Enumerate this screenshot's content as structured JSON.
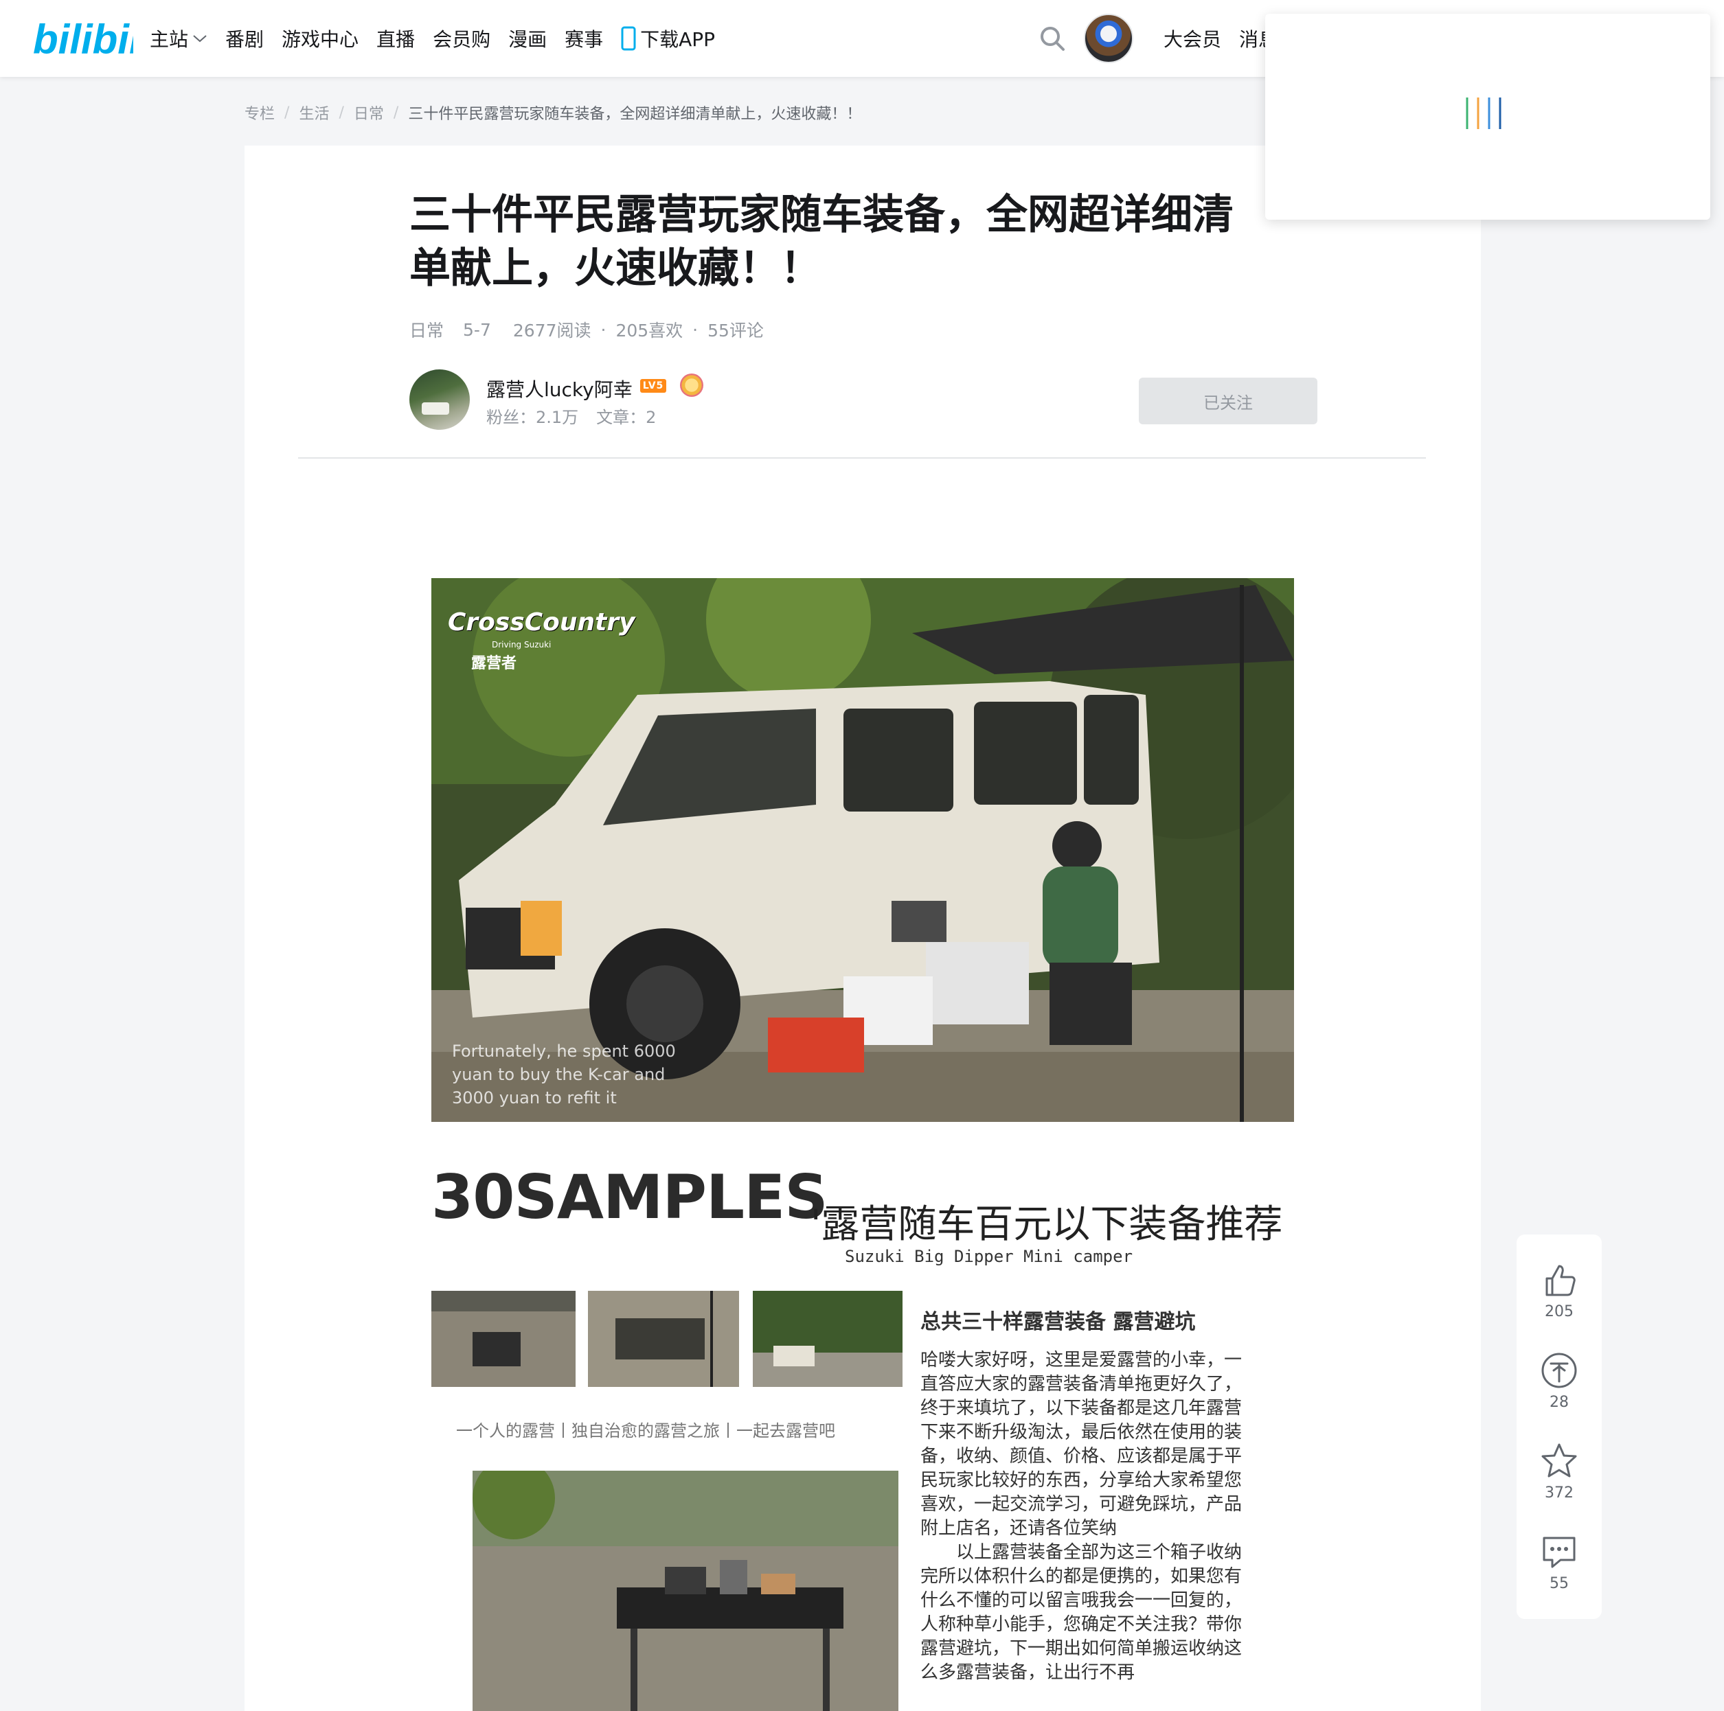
{
  "colors": {
    "brand": "#00aeec",
    "text": "#18191c",
    "muted": "#9499a0",
    "follow_bg": "#e3e5e7"
  },
  "header": {
    "logo": "bilibili",
    "nav": [
      {
        "label": "主站",
        "icon": "chevron-down-icon"
      },
      {
        "label": "番剧"
      },
      {
        "label": "游戏中心"
      },
      {
        "label": "直播"
      },
      {
        "label": "会员购"
      },
      {
        "label": "漫画"
      },
      {
        "label": "赛事"
      },
      {
        "label": "下载APP",
        "icon": "phone-icon"
      }
    ],
    "right": [
      "大会员",
      "消息"
    ]
  },
  "breadcrumb": [
    "专栏",
    "生活",
    "日常",
    "三十件平民露营玩家随车装备，全网超详细清单献上，火速收藏！！"
  ],
  "article": {
    "title": "三十件平民露营玩家随车装备，全网超详细清单献上，火速收藏！！",
    "category": "日常",
    "date": "5-7",
    "reads": "2677阅读",
    "likes": "205喜欢",
    "comments": "55评论"
  },
  "author": {
    "name": "露营人lucky阿幸",
    "level": "LV5",
    "fans": "粉丝：2.1万",
    "articles": "文章：2",
    "follow_label": "已关注"
  },
  "hero": {
    "brand": "CrossCountry",
    "brand_sub": "Driving Suzuki",
    "brand_camp": "露营者",
    "overlay": "Fortunately, he spent 6000 yuan to buy the K-car and 3000 yuan to refit it"
  },
  "samples": {
    "big_title": "30SAMPLES",
    "cn_title": "'露营随车百元以下装备推荐",
    "en_sub": "Suzuki Big Dipper Mini camper",
    "thumb_caption": "一个人的露营丨独自治愈的露营之旅丨一起去露营吧",
    "side_title": "总共三十样露营装备 露营避坑",
    "para1": "哈喽大家好呀，这里是爱露营的小幸，一直答应大家的露营装备清单拖更好久了，终于来填坑了，以下装备都是这几年露营下来不断升级淘汰，最后依然在使用的装备，收纳、颜值、价格、应该都是属于平民玩家比较好的东西，分享给大家希望您喜欢，一起交流学习，可避免踩坑，产品附上店名，还请各位笑纳",
    "para2": "以上露营装备全部为这三个箱子收纳完所以体积什么的都是便携的，如果您有什么不懂的可以留言哦我会一一回复的，人称种草小能手，您确定不关注我？带你露营避坑，下一期出如何简单搬运收纳这么多露营装备，让出行不再"
  },
  "actions": [
    {
      "name": "like",
      "icon": "thumbs-up-icon",
      "count": "205"
    },
    {
      "name": "coin",
      "icon": "coin-icon",
      "count": "28"
    },
    {
      "name": "favorite",
      "icon": "star-icon",
      "count": "372"
    },
    {
      "name": "comment",
      "icon": "comment-icon",
      "count": "55"
    }
  ]
}
